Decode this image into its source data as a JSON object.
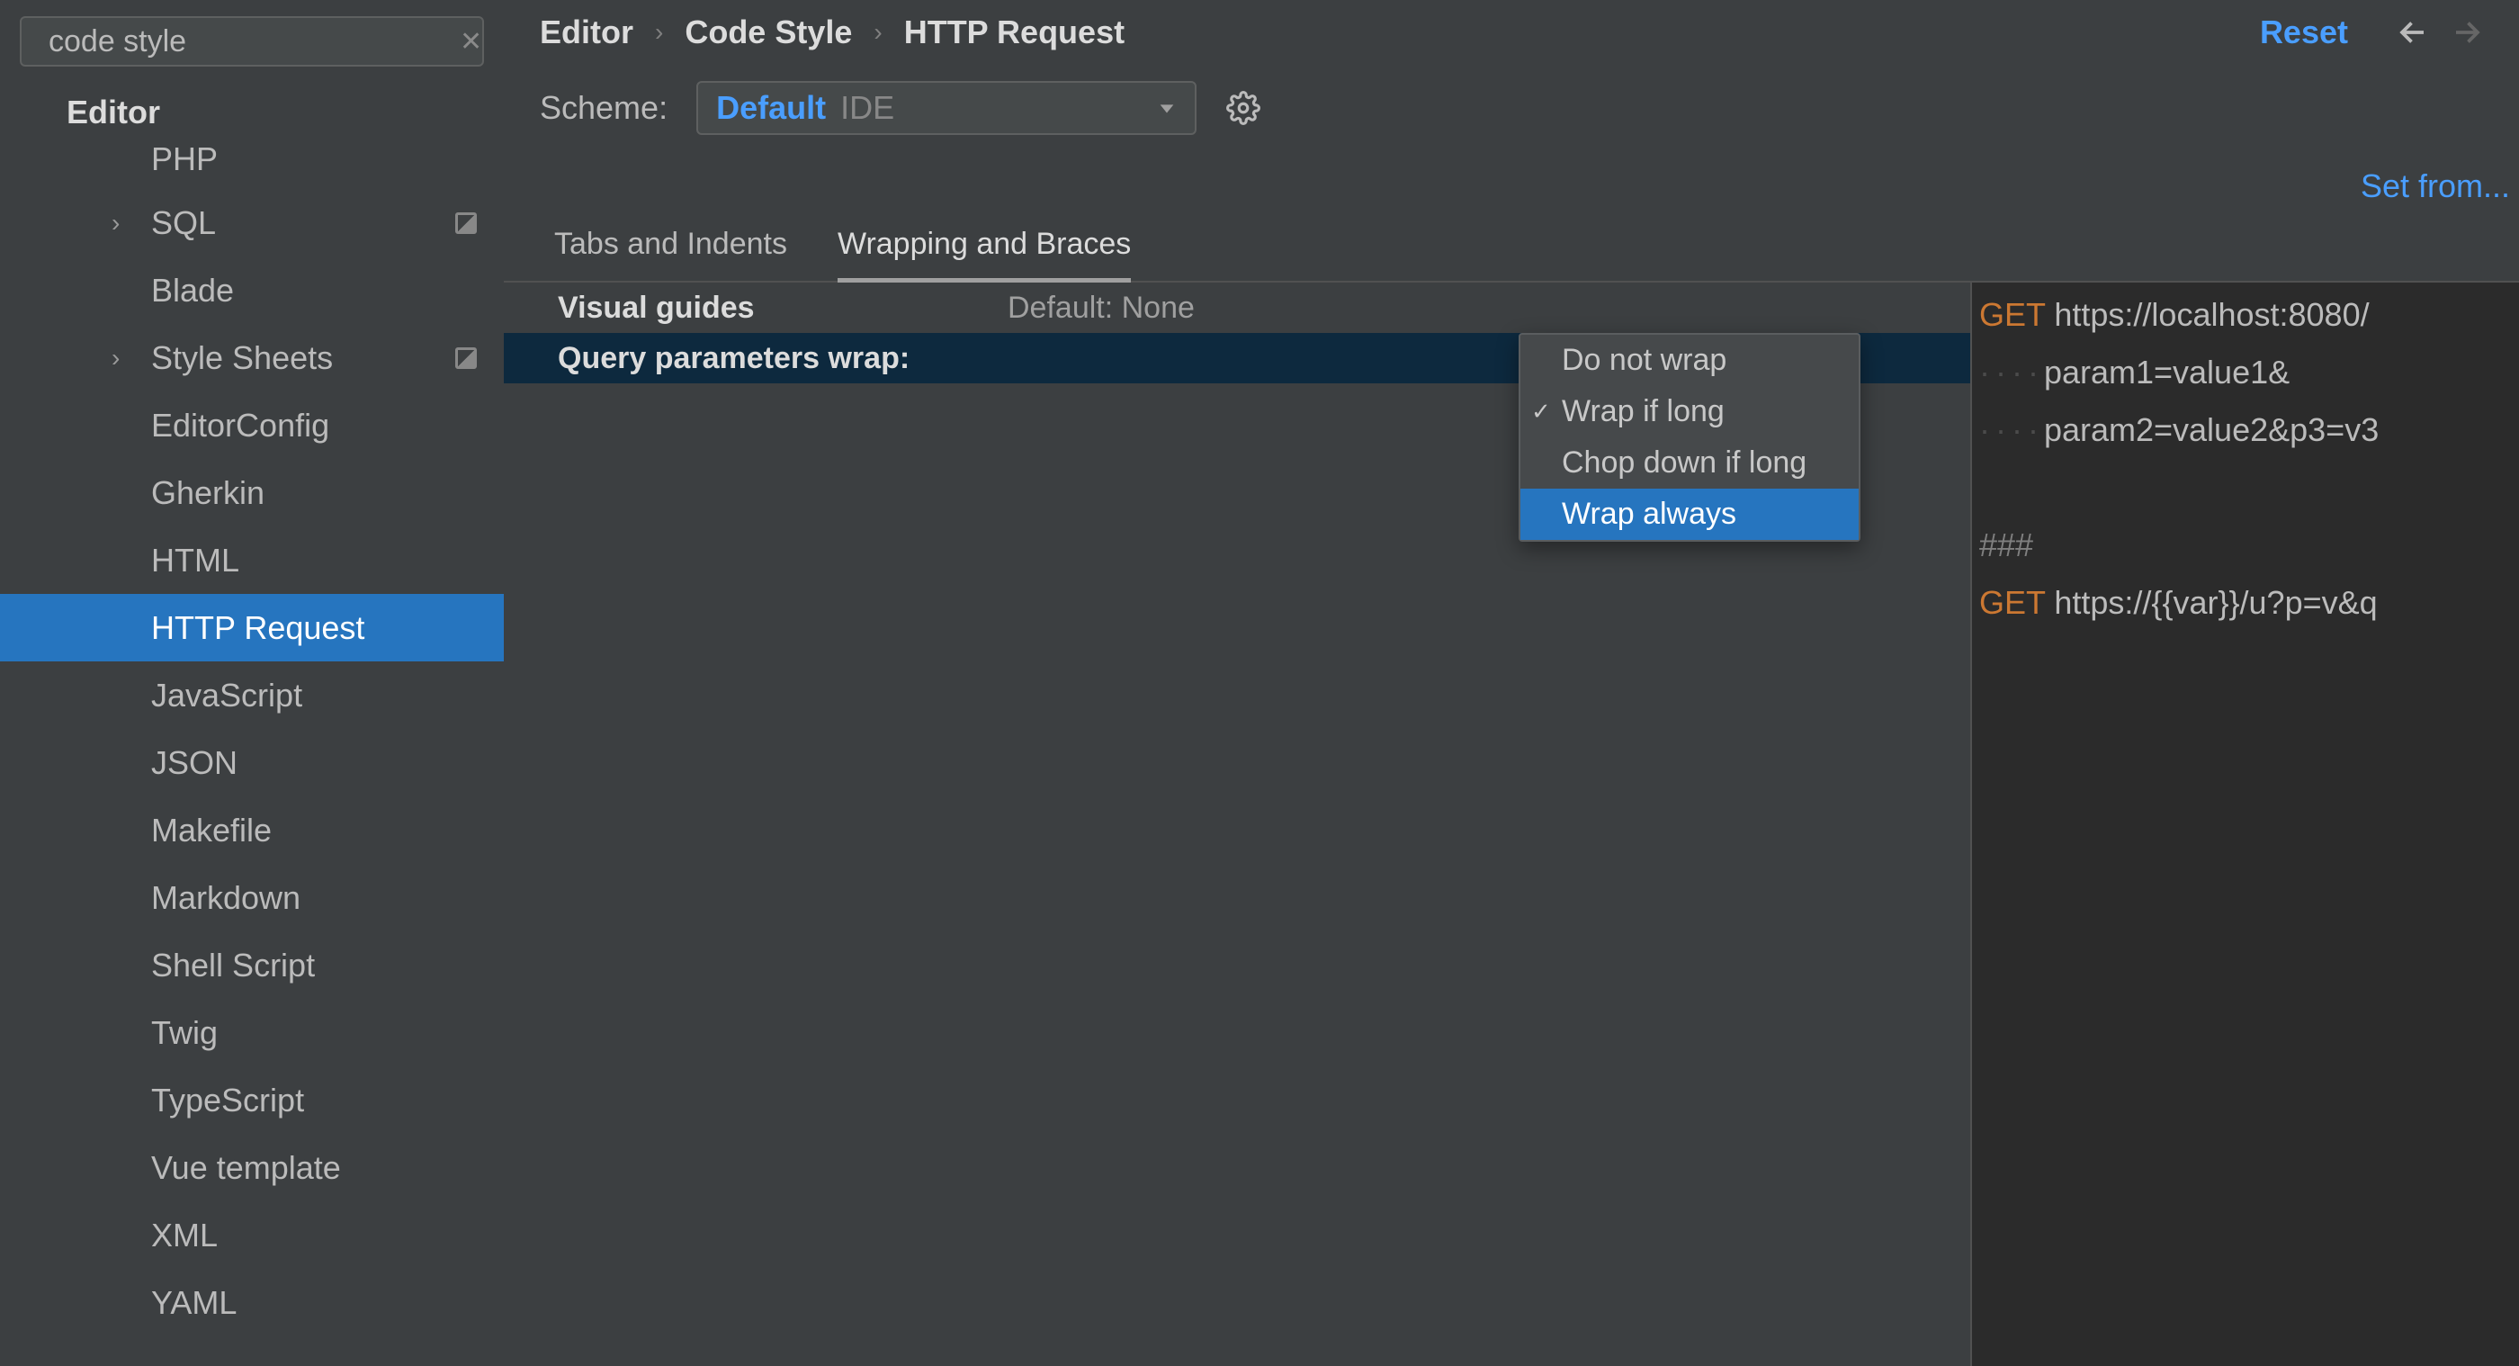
{
  "search": {
    "value": "code style"
  },
  "sidebar": {
    "group": "Editor",
    "items": [
      {
        "label": "PHP",
        "arrow": false,
        "square": false,
        "selected": false,
        "first": true
      },
      {
        "label": "SQL",
        "arrow": true,
        "square": true,
        "selected": false
      },
      {
        "label": "Blade",
        "arrow": false,
        "square": false,
        "selected": false
      },
      {
        "label": "Style Sheets",
        "arrow": true,
        "square": true,
        "selected": false
      },
      {
        "label": "EditorConfig",
        "arrow": false,
        "square": false,
        "selected": false
      },
      {
        "label": "Gherkin",
        "arrow": false,
        "square": false,
        "selected": false
      },
      {
        "label": "HTML",
        "arrow": false,
        "square": false,
        "selected": false
      },
      {
        "label": "HTTP Request",
        "arrow": false,
        "square": false,
        "selected": true
      },
      {
        "label": "JavaScript",
        "arrow": false,
        "square": false,
        "selected": false
      },
      {
        "label": "JSON",
        "arrow": false,
        "square": false,
        "selected": false
      },
      {
        "label": "Makefile",
        "arrow": false,
        "square": false,
        "selected": false
      },
      {
        "label": "Markdown",
        "arrow": false,
        "square": false,
        "selected": false
      },
      {
        "label": "Shell Script",
        "arrow": false,
        "square": false,
        "selected": false
      },
      {
        "label": "Twig",
        "arrow": false,
        "square": false,
        "selected": false
      },
      {
        "label": "TypeScript",
        "arrow": false,
        "square": false,
        "selected": false
      },
      {
        "label": "Vue template",
        "arrow": false,
        "square": false,
        "selected": false
      },
      {
        "label": "XML",
        "arrow": false,
        "square": false,
        "selected": false
      },
      {
        "label": "YAML",
        "arrow": false,
        "square": false,
        "selected": false
      }
    ]
  },
  "breadcrumb": [
    "Editor",
    "Code Style",
    "HTTP Request"
  ],
  "reset": "Reset",
  "scheme": {
    "label": "Scheme:",
    "name": "Default",
    "scope": "IDE"
  },
  "setfrom": "Set from...",
  "tabs": [
    {
      "label": "Tabs and Indents",
      "active": false
    },
    {
      "label": "Wrapping and Braces",
      "active": true
    }
  ],
  "settings": [
    {
      "label": "Visual guides",
      "value": "Default: None",
      "selected": false
    },
    {
      "label": "Query parameters wrap:",
      "value": "",
      "selected": true
    }
  ],
  "dropdown": {
    "items": [
      {
        "label": "Do not wrap",
        "checked": false,
        "highlight": false
      },
      {
        "label": "Wrap if long",
        "checked": true,
        "highlight": false
      },
      {
        "label": "Chop down if long",
        "checked": false,
        "highlight": false
      },
      {
        "label": "Wrap always",
        "checked": false,
        "highlight": true
      }
    ]
  },
  "preview": {
    "lines": [
      {
        "k": "get",
        "t": "https://localhost:8080/"
      },
      {
        "k": "cont",
        "t": "param1=value1&"
      },
      {
        "k": "cont",
        "t": "param2=value2&p3=v3"
      },
      {
        "k": "blank",
        "t": ""
      },
      {
        "k": "hash",
        "t": "###"
      },
      {
        "k": "get",
        "t": "https://{{var}}/u?p=v&q"
      }
    ]
  }
}
